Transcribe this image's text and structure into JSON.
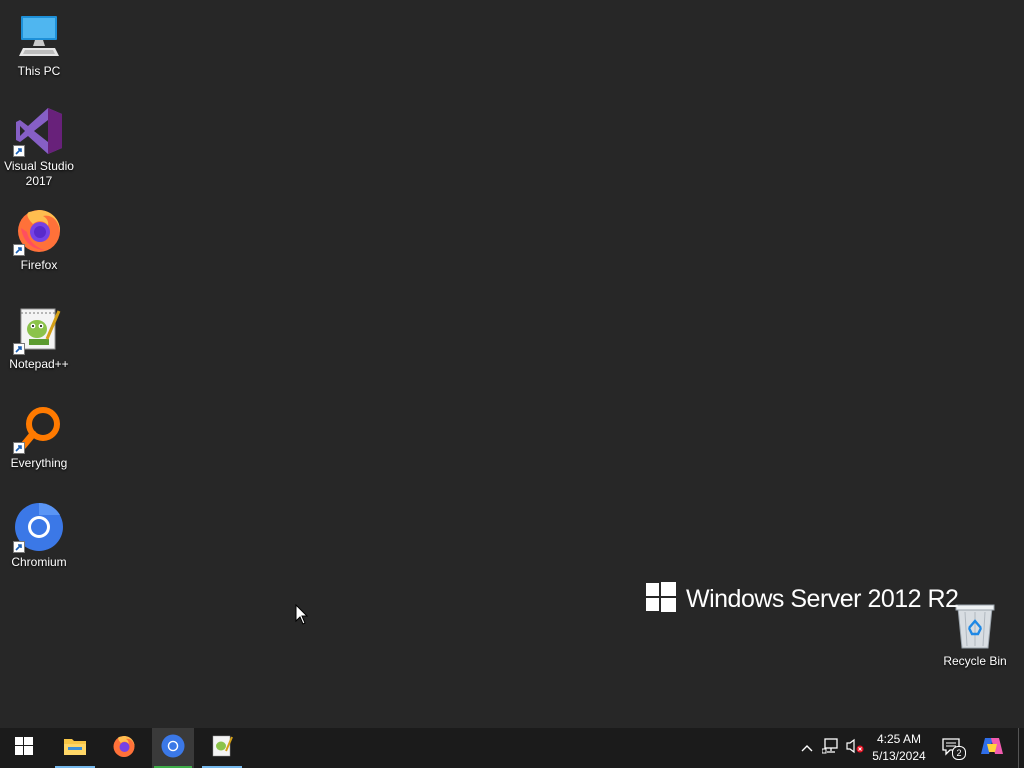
{
  "desktop": {
    "icons": [
      {
        "label": "This PC",
        "icon": "this-pc-icon"
      },
      {
        "label": "Visual Studio\n2017",
        "icon": "visual-studio-icon"
      },
      {
        "label": "Firefox",
        "icon": "firefox-icon"
      },
      {
        "label": "Notepad++",
        "icon": "notepad-plus-plus-icon"
      },
      {
        "label": "Everything",
        "icon": "everything-search-icon"
      },
      {
        "label": "Chromium",
        "icon": "chromium-icon"
      },
      {
        "label": "Recycle Bin",
        "icon": "recycle-bin-icon"
      }
    ],
    "watermark": "Windows Server 2012 R2"
  },
  "taskbar": {
    "start": "start-windows-icon",
    "pinned": [
      {
        "name": "file-explorer",
        "icon": "folder-icon",
        "running": true,
        "active": false
      },
      {
        "name": "firefox",
        "icon": "firefox-icon",
        "running": false,
        "active": false
      },
      {
        "name": "chromium",
        "icon": "chromium-icon",
        "running": true,
        "active": true
      },
      {
        "name": "notepad-plus-plus",
        "icon": "notepad-plus-plus-icon",
        "running": true,
        "active": false
      }
    ],
    "tray": {
      "time": "4:25 AM",
      "date": "5/13/2024",
      "notification_count": "2"
    }
  },
  "colors": {
    "desktop_bg": "#272727",
    "taskbar_bg": "#1b1b1b",
    "accent": "#76b9ed"
  }
}
